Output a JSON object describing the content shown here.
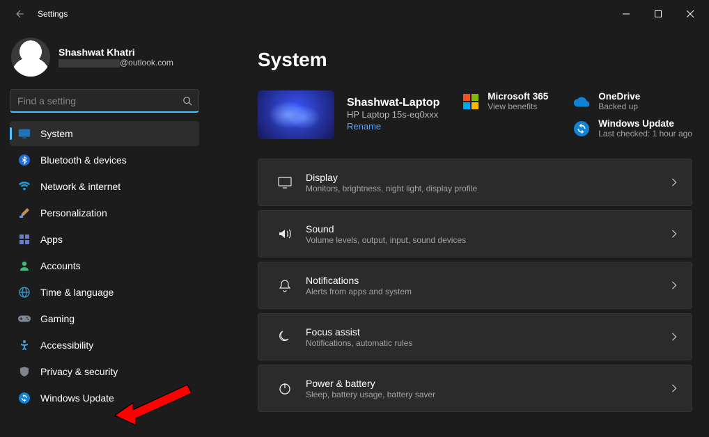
{
  "window": {
    "title": "Settings"
  },
  "profile": {
    "name": "Shashwat Khatri",
    "email_suffix": "@outlook.com"
  },
  "search": {
    "placeholder": "Find a setting"
  },
  "sidebar": {
    "items": [
      {
        "label": "System",
        "icon": "display-icon",
        "active": true
      },
      {
        "label": "Bluetooth & devices",
        "icon": "bluetooth-icon"
      },
      {
        "label": "Network & internet",
        "icon": "wifi-icon"
      },
      {
        "label": "Personalization",
        "icon": "brush-icon"
      },
      {
        "label": "Apps",
        "icon": "apps-icon"
      },
      {
        "label": "Accounts",
        "icon": "person-icon"
      },
      {
        "label": "Time & language",
        "icon": "globe-icon"
      },
      {
        "label": "Gaming",
        "icon": "gamepad-icon"
      },
      {
        "label": "Accessibility",
        "icon": "accessibility-icon"
      },
      {
        "label": "Privacy & security",
        "icon": "shield-icon"
      },
      {
        "label": "Windows Update",
        "icon": "sync-icon"
      }
    ]
  },
  "page": {
    "title": "System"
  },
  "device": {
    "name": "Shashwat-Laptop",
    "model": "HP Laptop 15s-eq0xxx",
    "rename": "Rename"
  },
  "widgets": {
    "ms365": {
      "title": "Microsoft 365",
      "sub": "View benefits"
    },
    "onedrive": {
      "title": "OneDrive",
      "sub": "Backed up"
    },
    "update": {
      "title": "Windows Update",
      "sub": "Last checked: 1 hour ago"
    }
  },
  "cards": [
    {
      "key": "display",
      "title": "Display",
      "sub": "Monitors, brightness, night light, display profile"
    },
    {
      "key": "sound",
      "title": "Sound",
      "sub": "Volume levels, output, input, sound devices"
    },
    {
      "key": "notifications",
      "title": "Notifications",
      "sub": "Alerts from apps and system"
    },
    {
      "key": "focus",
      "title": "Focus assist",
      "sub": "Notifications, automatic rules"
    },
    {
      "key": "power",
      "title": "Power & battery",
      "sub": "Sleep, battery usage, battery saver"
    }
  ]
}
